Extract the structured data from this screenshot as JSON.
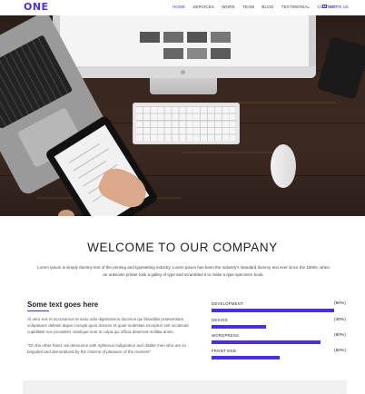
{
  "nav": {
    "logo": "ONE",
    "items": [
      "HOME",
      "SERVICES",
      "WORK",
      "TEAM",
      "BLOG",
      "TESTIMONIAL",
      "CONTACT"
    ],
    "active": "HOME",
    "write_us": "WRITE US",
    "accent": "#4a2fe0"
  },
  "welcome": {
    "title": "WELCOME TO OUR COMPANY",
    "text": "Lorem Ipsum is simply dummy text of the printing and typesetting industry. Lorem Ipsum has been the industry's standard dummy text ever since the 1500s, when an unknown printer took a galley of type and scrambled it to make a type specimen book."
  },
  "about": {
    "title": "Some text goes here",
    "para1": "At vero eos et accusamus et iusto odio dignissimos ducimus qui blanditiis praesentium voluptatum deleniti atque corrupti quos dolores et quas molestias excepturi sint occaecati cupiditate non provident, similique sunt in culpa qui officia deserunt mollitia animi.",
    "para2": "\"On the other hand, we denounce with righteous indignation and dislike men who are so beguiled and demoralized by the charms of pleasure of the moment\"."
  },
  "skills": [
    {
      "name": "DEVELOPMENT",
      "pct_label": "(90%)",
      "value": 90
    },
    {
      "name": "DESIGN",
      "pct_label": "(40%)",
      "value": 40
    },
    {
      "name": "WORDPRESS",
      "pct_label": "(80%)",
      "value": 80
    },
    {
      "name": "FRONT END",
      "pct_label": "(50%)",
      "value": 50
    }
  ]
}
